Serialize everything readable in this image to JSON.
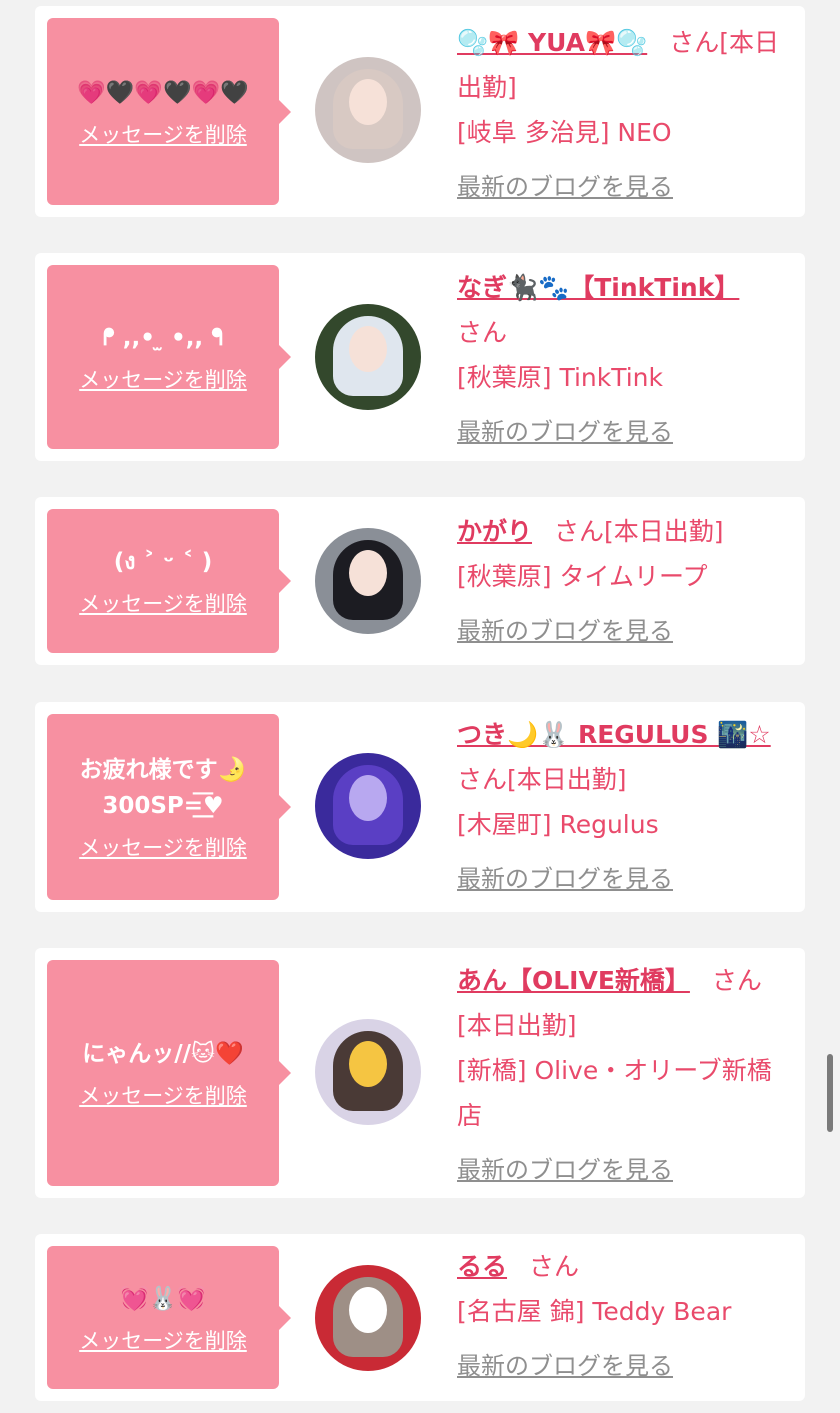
{
  "delete_label": "メッセージを削除",
  "blog_label": "最新のブログを見る",
  "cards": [
    {
      "message": "💗🖤💗🖤💗🖤",
      "name": "🫧🎀 YUA🎀🫧",
      "san": "さん[本日出勤]",
      "shop": "[岐阜 多治見] NEO"
    },
    {
      "message": "ᖰ ,,•  ̫ •,, ᖳ",
      "name": "なぎ🐈‍⬛🐾【TinkTink】",
      "san": "さん",
      "shop": "[秋葉原] TinkTink"
    },
    {
      "message": "(ง ˃ ᵕ ˂ )",
      "name": "かがり",
      "san": "さん[本日出勤]",
      "shop": "[秋葉原] タイムリープ"
    },
    {
      "message": "お疲れ様です🌛\n300SP=͟͟͞♥",
      "name": "つき🌙🐰 REGULUS 🌃☆",
      "san": "さん[本日出勤]",
      "shop": "[木屋町] Regulus"
    },
    {
      "message": "にゃんッ//🐱❤️",
      "name": "あん【OLIVE新橋】",
      "san": "さん[本日出勤]",
      "shop": "[新橋] Olive・オリーブ新橋店"
    },
    {
      "message": "💓🐰💓",
      "name": "るる",
      "san": "さん",
      "shop": "[名古屋 錦] Teddy Bear"
    }
  ],
  "colors": {
    "bubble": "#f790a1",
    "name": "#e03b60",
    "text": "#e94a6b",
    "link": "#8f8f8f"
  }
}
